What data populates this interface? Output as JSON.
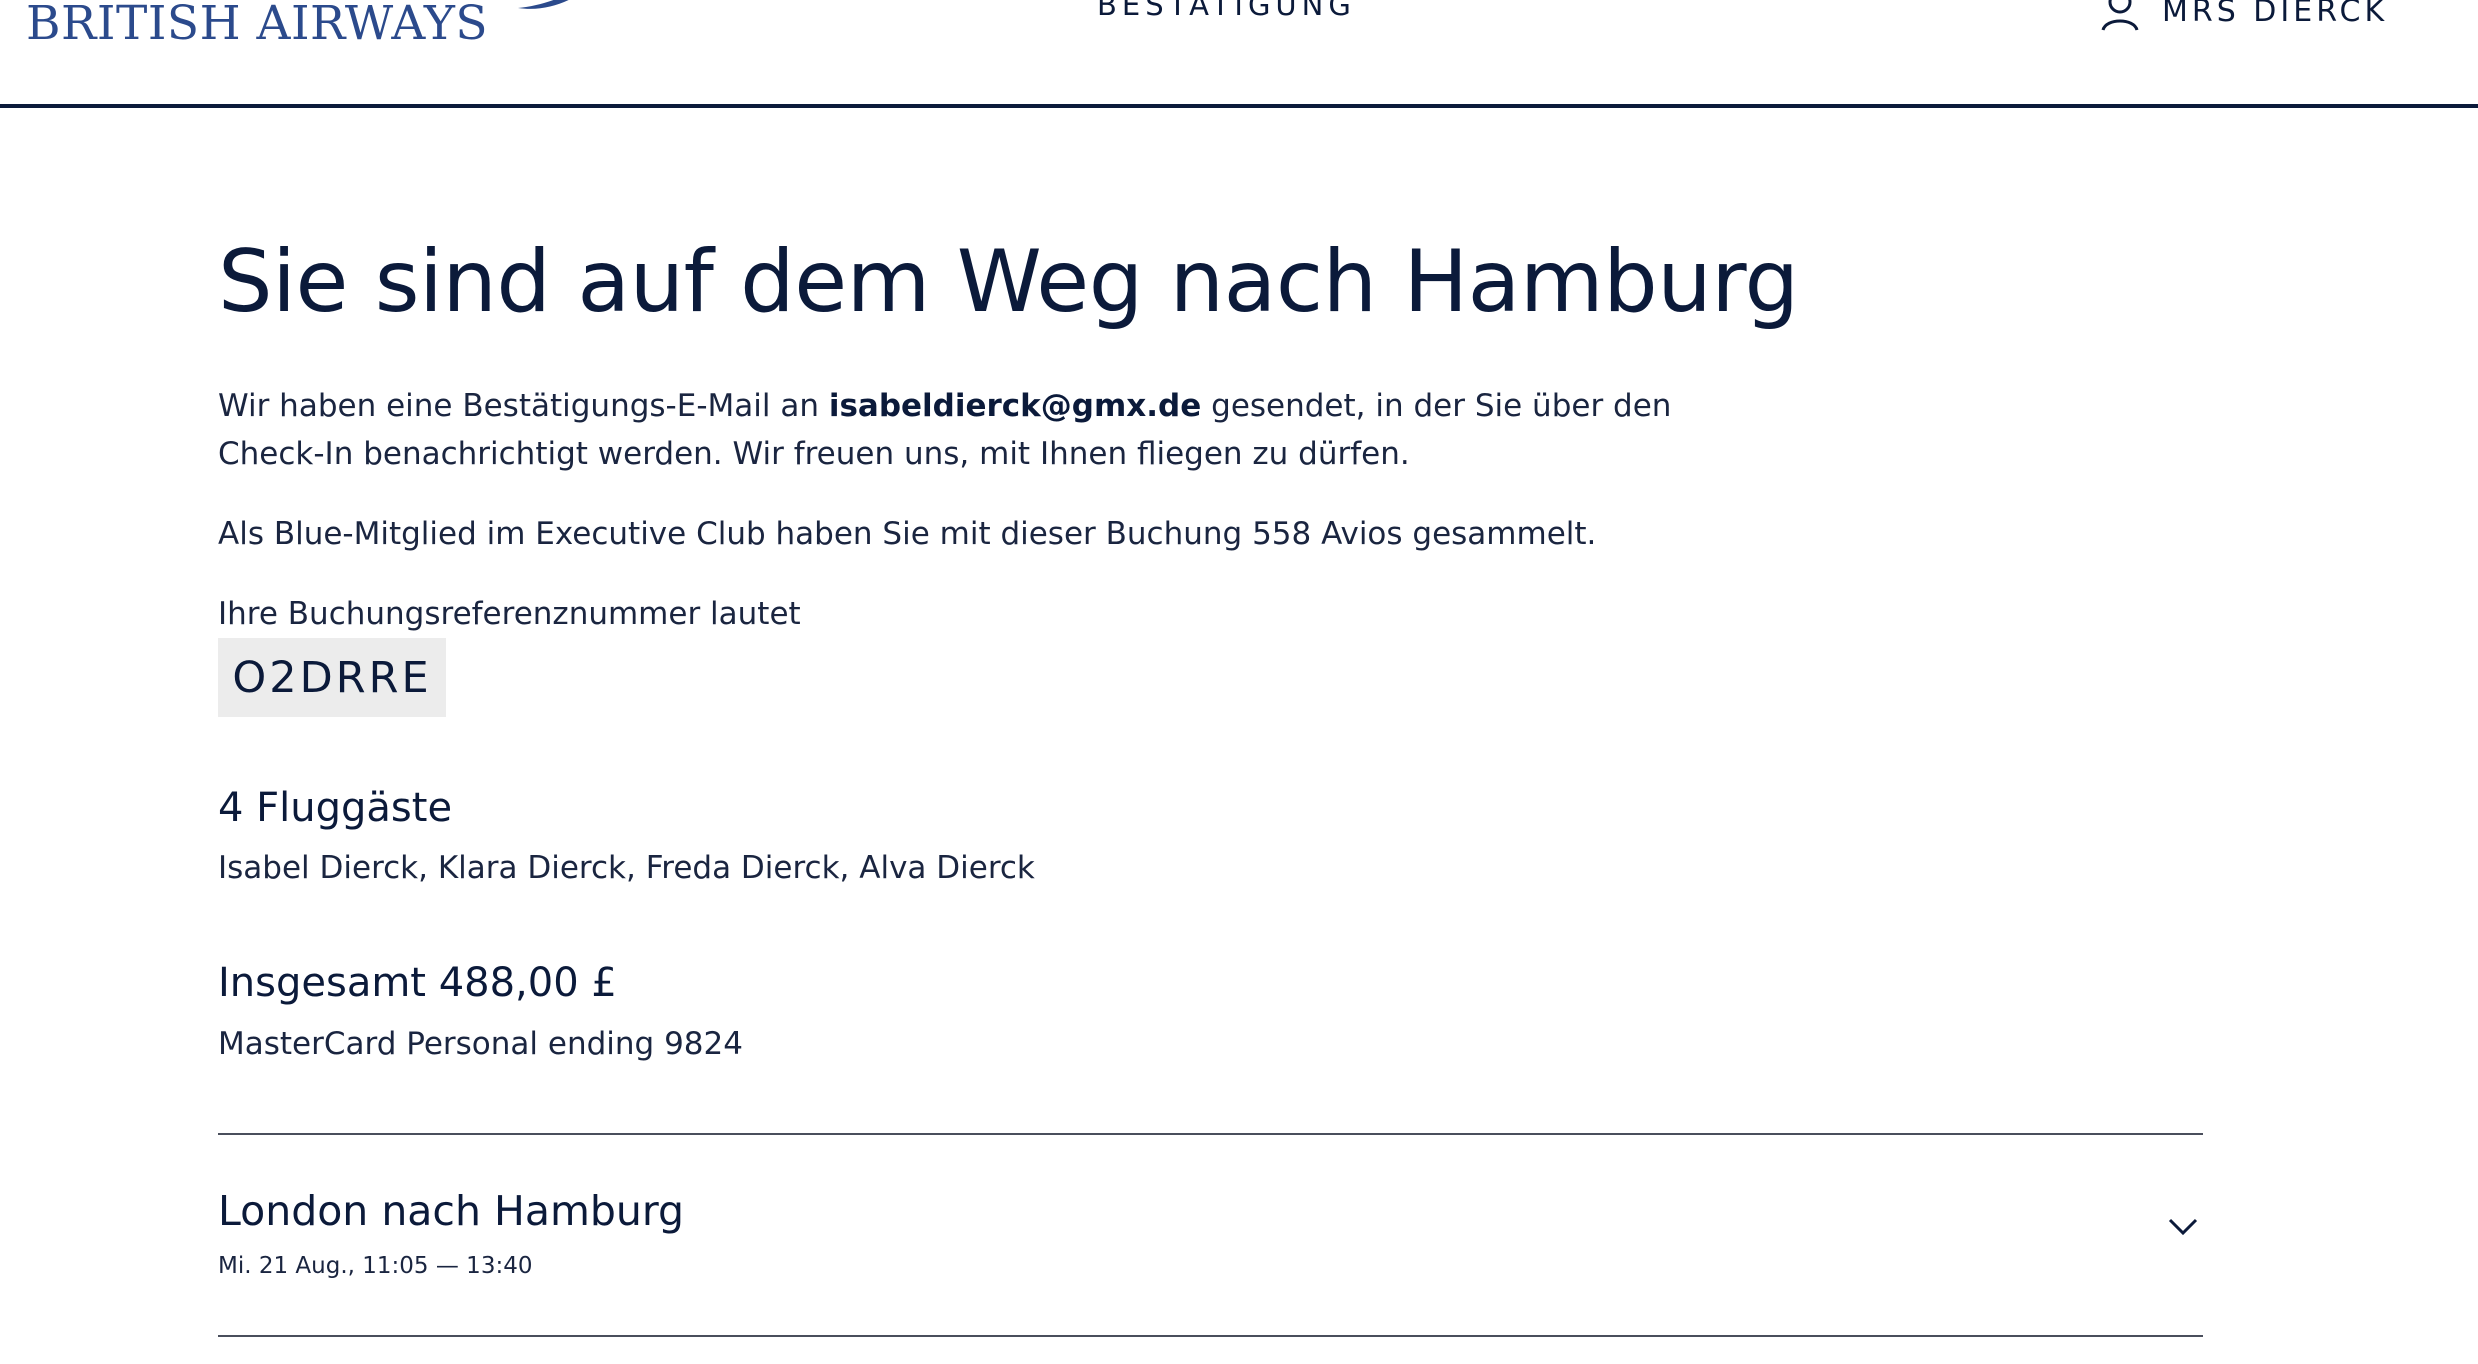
{
  "header": {
    "brand": "BRITISH AIRWAYS",
    "step": "BESTÄTIGUNG",
    "user_name": "MRS DIERCK"
  },
  "confirmation": {
    "title": "Sie sind auf dem Weg nach Hamburg",
    "email_intro": "Wir haben eine Bestätigungs-E-Mail an ",
    "email": "isabeldierck@gmx.de",
    "email_outro_1": " gesendet, in der Sie über den",
    "email_outro_2": "Check-In benachrichtigt werden. Wir freuen uns, mit Ihnen fliegen zu dürfen.",
    "avios_text": "Als Blue-Mitglied im Executive Club haben Sie mit dieser Buchung 558 Avios gesammelt.",
    "reference_label": "Ihre Buchungsreferenznummer lautet",
    "reference": "O2DRRE"
  },
  "passengers": {
    "title": "4 Fluggäste",
    "names": "Isabel Dierck, Klara Dierck, Freda Dierck, Alva Dierck"
  },
  "payment": {
    "total": "Insgesamt 488,00 £",
    "card": "MasterCard Personal ending 9824"
  },
  "flight": {
    "route": "London nach Hamburg",
    "time": "Mi. 21 Aug., 11:05 — 13:40"
  },
  "colors": {
    "brand_blue": "#2b4a8c",
    "navy": "#0b1a3a",
    "reference_bg": "#ececec"
  }
}
